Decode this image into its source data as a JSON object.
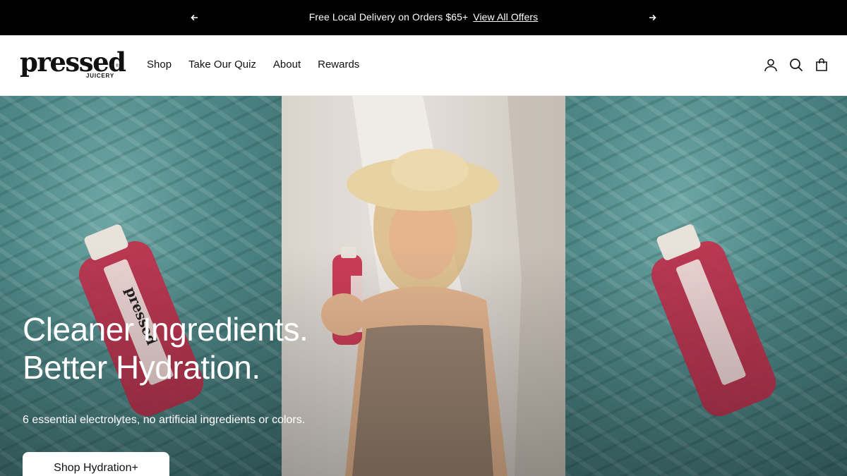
{
  "announcement": {
    "text": "Free Local Delivery on Orders $65+",
    "link": "View All Offers",
    "prev_icon": "arrow-left-icon",
    "next_icon": "arrow-right-icon"
  },
  "brand": {
    "name": "pressed",
    "sub": "JUICERY",
    "reg": "®"
  },
  "nav": {
    "items": [
      {
        "label": "Shop"
      },
      {
        "label": "Take Our Quiz"
      },
      {
        "label": "About"
      },
      {
        "label": "Rewards"
      }
    ]
  },
  "header_icons": [
    "account-icon",
    "search-icon",
    "cart-icon"
  ],
  "hero": {
    "title_line1": "Cleaner Ingredients.",
    "title_line2": "Better Hydration.",
    "subtitle": "6 essential electrolytes, no artificial ingredients or colors.",
    "cta": "Shop Hydration+",
    "bottle_label": "pressed"
  },
  "colors": {
    "announcement_bg": "#000000",
    "accent_juice": "#c0304c",
    "water": "#4f8787"
  }
}
